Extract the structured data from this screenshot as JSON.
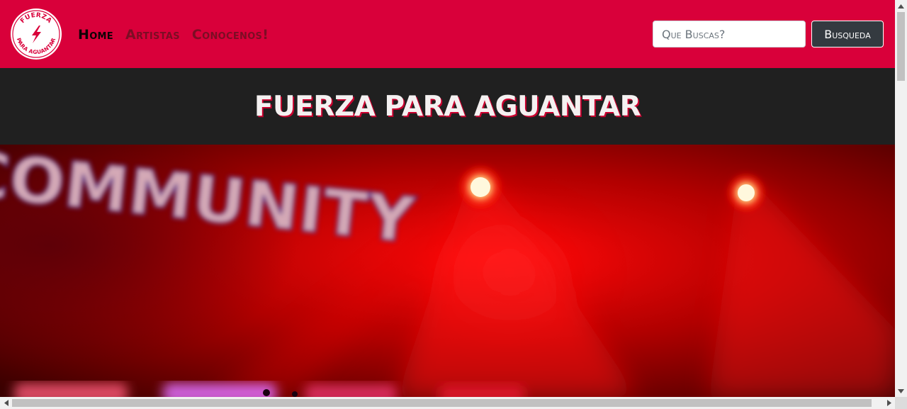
{
  "navbar": {
    "logo_text_top": "FUERZA",
    "logo_text_bottom": "PARA AGUANTAR",
    "logo_icon": "lightning-bolt-icon",
    "links": [
      {
        "label": "Home",
        "active": true
      },
      {
        "label": "Artistas",
        "active": false
      },
      {
        "label": "Conocenos!",
        "active": false
      }
    ],
    "search": {
      "placeholder": "Que Buscas?",
      "value": ""
    },
    "search_button_label": "Busqueda"
  },
  "hero": {
    "title": "FUERZA PARA AGUANTAR",
    "image_sign_text": "COMMUNITY"
  },
  "colors": {
    "navbar_bg": "#d9003a",
    "title_band_bg": "#202020",
    "button_bg": "#343a40",
    "link_color": "#7c0d24",
    "active_link_color": "#0d0306"
  }
}
